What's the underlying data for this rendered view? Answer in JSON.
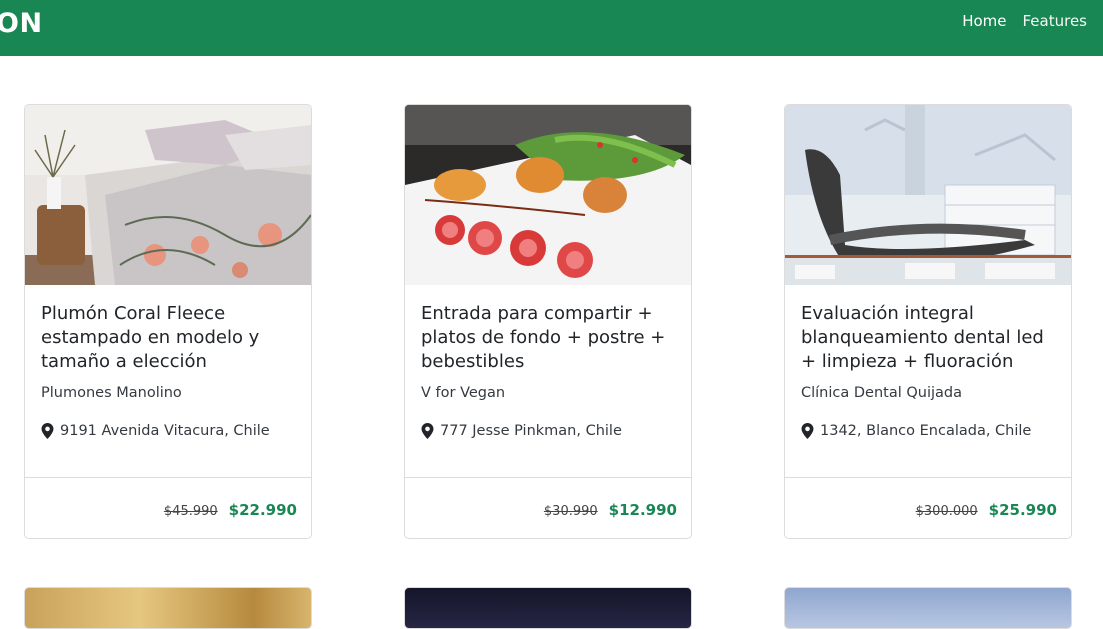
{
  "navbar": {
    "brand": "ON",
    "links": [
      {
        "label": "Home"
      },
      {
        "label": "Features"
      }
    ],
    "color": "#198754"
  },
  "deals": [
    {
      "title": "Plumón Coral Fleece estampado en modelo y tamaño a elección",
      "merchant": "Plumones Manolino",
      "location": "9191 Avenida Vitacura, Chile",
      "old_price": "$45.990",
      "new_price": "$22.990",
      "image": "bedding-photo"
    },
    {
      "title": "Entrada para compartir + platos de fondo + postre + bebestibles",
      "merchant": "V for Vegan",
      "location": "777 Jesse Pinkman, Chile",
      "old_price": "$30.990",
      "new_price": "$12.990",
      "image": "food-plate-photo"
    },
    {
      "title": "Evaluación integral blanqueamiento dental led + limpieza + fluoración",
      "merchant": "Clínica Dental Quijada",
      "location": "1342, Blanco Encalada, Chile",
      "old_price": "$300.000",
      "new_price": "$25.990",
      "image": "dental-clinic-photo"
    }
  ],
  "price_color": "#198754"
}
